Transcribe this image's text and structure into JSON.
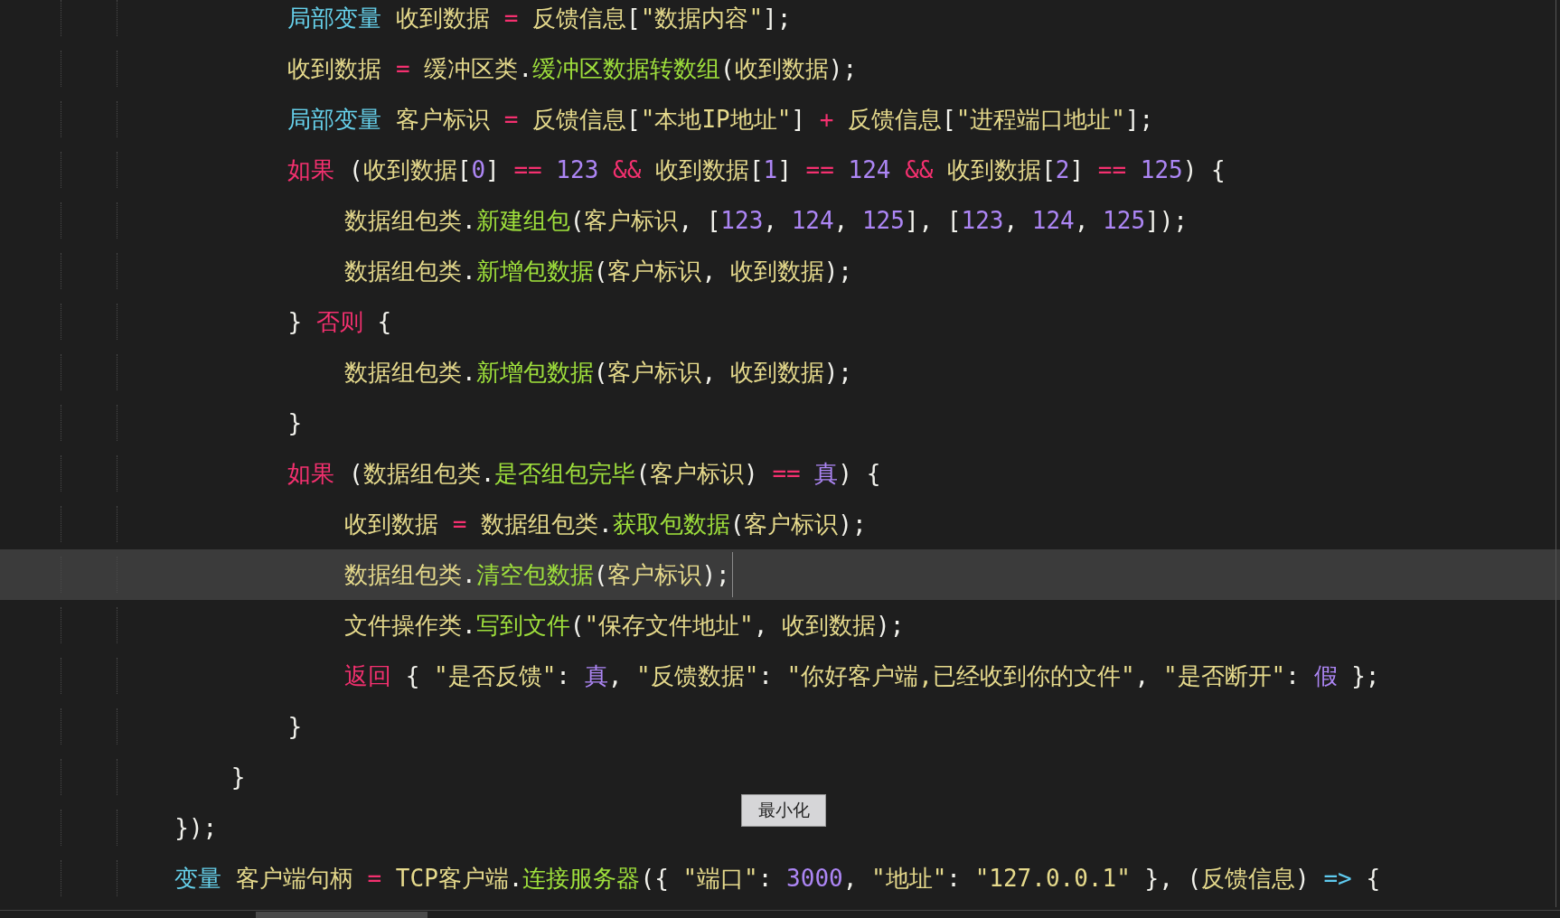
{
  "editor": {
    "lines": [
      {
        "current": false,
        "tokens": [
          {
            "kind": "k",
            "text": "                局部变量"
          },
          {
            "kind": "i",
            "text": " 收到数据"
          },
          {
            "kind": "o",
            "text": " = "
          },
          {
            "kind": "i",
            "text": "反馈信息"
          },
          {
            "kind": "p",
            "text": "["
          },
          {
            "kind": "s",
            "text": "\"数据内容\""
          },
          {
            "kind": "p",
            "text": "];"
          }
        ]
      },
      {
        "current": false,
        "tokens": [
          {
            "kind": "i",
            "text": "                收到数据"
          },
          {
            "kind": "o",
            "text": " = "
          },
          {
            "kind": "i",
            "text": "缓冲区类"
          },
          {
            "kind": "p",
            "text": "."
          },
          {
            "kind": "f",
            "text": "缓冲区数据转数组"
          },
          {
            "kind": "p",
            "text": "("
          },
          {
            "kind": "i",
            "text": "收到数据"
          },
          {
            "kind": "p",
            "text": ");"
          }
        ]
      },
      {
        "current": false,
        "tokens": [
          {
            "kind": "k",
            "text": "                局部变量"
          },
          {
            "kind": "i",
            "text": " 客户标识"
          },
          {
            "kind": "o",
            "text": " = "
          },
          {
            "kind": "i",
            "text": "反馈信息"
          },
          {
            "kind": "p",
            "text": "["
          },
          {
            "kind": "s",
            "text": "\"本地IP地址\""
          },
          {
            "kind": "p",
            "text": "]"
          },
          {
            "kind": "o",
            "text": " + "
          },
          {
            "kind": "i",
            "text": "反馈信息"
          },
          {
            "kind": "p",
            "text": "["
          },
          {
            "kind": "s",
            "text": "\"进程端口地址\""
          },
          {
            "kind": "p",
            "text": "];"
          }
        ]
      },
      {
        "current": false,
        "tokens": [
          {
            "kind": "c",
            "text": "                如果"
          },
          {
            "kind": "p",
            "text": " ("
          },
          {
            "kind": "i",
            "text": "收到数据"
          },
          {
            "kind": "p",
            "text": "["
          },
          {
            "kind": "n",
            "text": "0"
          },
          {
            "kind": "p",
            "text": "]"
          },
          {
            "kind": "o",
            "text": " == "
          },
          {
            "kind": "n",
            "text": "123"
          },
          {
            "kind": "o",
            "text": " && "
          },
          {
            "kind": "i",
            "text": "收到数据"
          },
          {
            "kind": "p",
            "text": "["
          },
          {
            "kind": "n",
            "text": "1"
          },
          {
            "kind": "p",
            "text": "]"
          },
          {
            "kind": "o",
            "text": " == "
          },
          {
            "kind": "n",
            "text": "124"
          },
          {
            "kind": "o",
            "text": " && "
          },
          {
            "kind": "i",
            "text": "收到数据"
          },
          {
            "kind": "p",
            "text": "["
          },
          {
            "kind": "n",
            "text": "2"
          },
          {
            "kind": "p",
            "text": "]"
          },
          {
            "kind": "o",
            "text": " == "
          },
          {
            "kind": "n",
            "text": "125"
          },
          {
            "kind": "p",
            "text": ") {"
          }
        ]
      },
      {
        "current": false,
        "tokens": [
          {
            "kind": "i",
            "text": "                    数据组包类"
          },
          {
            "kind": "p",
            "text": "."
          },
          {
            "kind": "f",
            "text": "新建组包"
          },
          {
            "kind": "p",
            "text": "("
          },
          {
            "kind": "i",
            "text": "客户标识"
          },
          {
            "kind": "p",
            "text": ", ["
          },
          {
            "kind": "n",
            "text": "123"
          },
          {
            "kind": "p",
            "text": ", "
          },
          {
            "kind": "n",
            "text": "124"
          },
          {
            "kind": "p",
            "text": ", "
          },
          {
            "kind": "n",
            "text": "125"
          },
          {
            "kind": "p",
            "text": "], ["
          },
          {
            "kind": "n",
            "text": "123"
          },
          {
            "kind": "p",
            "text": ", "
          },
          {
            "kind": "n",
            "text": "124"
          },
          {
            "kind": "p",
            "text": ", "
          },
          {
            "kind": "n",
            "text": "125"
          },
          {
            "kind": "p",
            "text": "]);"
          }
        ]
      },
      {
        "current": false,
        "tokens": [
          {
            "kind": "i",
            "text": "                    数据组包类"
          },
          {
            "kind": "p",
            "text": "."
          },
          {
            "kind": "f",
            "text": "新增包数据"
          },
          {
            "kind": "p",
            "text": "("
          },
          {
            "kind": "i",
            "text": "客户标识"
          },
          {
            "kind": "p",
            "text": ", "
          },
          {
            "kind": "i",
            "text": "收到数据"
          },
          {
            "kind": "p",
            "text": ");"
          }
        ]
      },
      {
        "current": false,
        "tokens": [
          {
            "kind": "p",
            "text": "                } "
          },
          {
            "kind": "c",
            "text": "否则"
          },
          {
            "kind": "p",
            "text": " {"
          }
        ]
      },
      {
        "current": false,
        "tokens": [
          {
            "kind": "i",
            "text": "                    数据组包类"
          },
          {
            "kind": "p",
            "text": "."
          },
          {
            "kind": "f",
            "text": "新增包数据"
          },
          {
            "kind": "p",
            "text": "("
          },
          {
            "kind": "i",
            "text": "客户标识"
          },
          {
            "kind": "p",
            "text": ", "
          },
          {
            "kind": "i",
            "text": "收到数据"
          },
          {
            "kind": "p",
            "text": ");"
          }
        ]
      },
      {
        "current": false,
        "tokens": [
          {
            "kind": "p",
            "text": "                }"
          }
        ]
      },
      {
        "current": false,
        "tokens": [
          {
            "kind": "c",
            "text": "                如果"
          },
          {
            "kind": "p",
            "text": " ("
          },
          {
            "kind": "i",
            "text": "数据组包类"
          },
          {
            "kind": "p",
            "text": "."
          },
          {
            "kind": "f",
            "text": "是否组包完毕"
          },
          {
            "kind": "p",
            "text": "("
          },
          {
            "kind": "i",
            "text": "客户标识"
          },
          {
            "kind": "p",
            "text": ")"
          },
          {
            "kind": "o",
            "text": " == "
          },
          {
            "kind": "n",
            "text": "真"
          },
          {
            "kind": "p",
            "text": ") {"
          }
        ]
      },
      {
        "current": false,
        "tokens": [
          {
            "kind": "i",
            "text": "                    收到数据"
          },
          {
            "kind": "o",
            "text": " = "
          },
          {
            "kind": "i",
            "text": "数据组包类"
          },
          {
            "kind": "p",
            "text": "."
          },
          {
            "kind": "f",
            "text": "获取包数据"
          },
          {
            "kind": "p",
            "text": "("
          },
          {
            "kind": "i",
            "text": "客户标识"
          },
          {
            "kind": "p",
            "text": ");"
          }
        ]
      },
      {
        "current": true,
        "tokens": [
          {
            "kind": "i",
            "text": "                    数据组包类"
          },
          {
            "kind": "p",
            "text": "."
          },
          {
            "kind": "f",
            "text": "清空包数据"
          },
          {
            "kind": "p",
            "text": "("
          },
          {
            "kind": "i",
            "text": "客户标识"
          },
          {
            "kind": "p",
            "text": ");"
          }
        ]
      },
      {
        "current": false,
        "tokens": [
          {
            "kind": "i",
            "text": "                    文件操作类"
          },
          {
            "kind": "p",
            "text": "."
          },
          {
            "kind": "f",
            "text": "写到文件"
          },
          {
            "kind": "p",
            "text": "("
          },
          {
            "kind": "s",
            "text": "\"保存文件地址\""
          },
          {
            "kind": "p",
            "text": ", "
          },
          {
            "kind": "i",
            "text": "收到数据"
          },
          {
            "kind": "p",
            "text": ");"
          }
        ]
      },
      {
        "current": false,
        "tokens": [
          {
            "kind": "c",
            "text": "                    返回"
          },
          {
            "kind": "p",
            "text": " { "
          },
          {
            "kind": "s",
            "text": "\"是否反馈\""
          },
          {
            "kind": "p",
            "text": ": "
          },
          {
            "kind": "n",
            "text": "真"
          },
          {
            "kind": "p",
            "text": ", "
          },
          {
            "kind": "s",
            "text": "\"反馈数据\""
          },
          {
            "kind": "p",
            "text": ": "
          },
          {
            "kind": "s",
            "text": "\"你好客户端,已经收到你的文件\""
          },
          {
            "kind": "p",
            "text": ", "
          },
          {
            "kind": "s",
            "text": "\"是否断开\""
          },
          {
            "kind": "p",
            "text": ": "
          },
          {
            "kind": "n",
            "text": "假"
          },
          {
            "kind": "p",
            "text": " };"
          }
        ]
      },
      {
        "current": false,
        "tokens": [
          {
            "kind": "p",
            "text": "                }"
          }
        ]
      },
      {
        "current": false,
        "tokens": [
          {
            "kind": "p",
            "text": "            }"
          }
        ]
      },
      {
        "current": false,
        "tokens": [
          {
            "kind": "p",
            "text": "        });"
          }
        ]
      },
      {
        "current": false,
        "tokens": [
          {
            "kind": "k",
            "text": "        变量"
          },
          {
            "kind": "i",
            "text": " 客户端句柄"
          },
          {
            "kind": "o",
            "text": " = "
          },
          {
            "kind": "i",
            "text": "TCP客户端"
          },
          {
            "kind": "p",
            "text": "."
          },
          {
            "kind": "f",
            "text": "连接服务器"
          },
          {
            "kind": "p",
            "text": "({ "
          },
          {
            "kind": "s",
            "text": "\"端口\""
          },
          {
            "kind": "p",
            "text": ": "
          },
          {
            "kind": "n",
            "text": "3000"
          },
          {
            "kind": "p",
            "text": ", "
          },
          {
            "kind": "s",
            "text": "\"地址\""
          },
          {
            "kind": "p",
            "text": ": "
          },
          {
            "kind": "s",
            "text": "\"127.0.0.1\""
          },
          {
            "kind": "p",
            "text": " }, ("
          },
          {
            "kind": "i",
            "text": "反馈信息"
          },
          {
            "kind": "p",
            "text": ")"
          },
          {
            "kind": "a",
            "text": " => "
          },
          {
            "kind": "p",
            "text": "{"
          }
        ]
      }
    ]
  },
  "tooltip": {
    "text": "最小化"
  }
}
